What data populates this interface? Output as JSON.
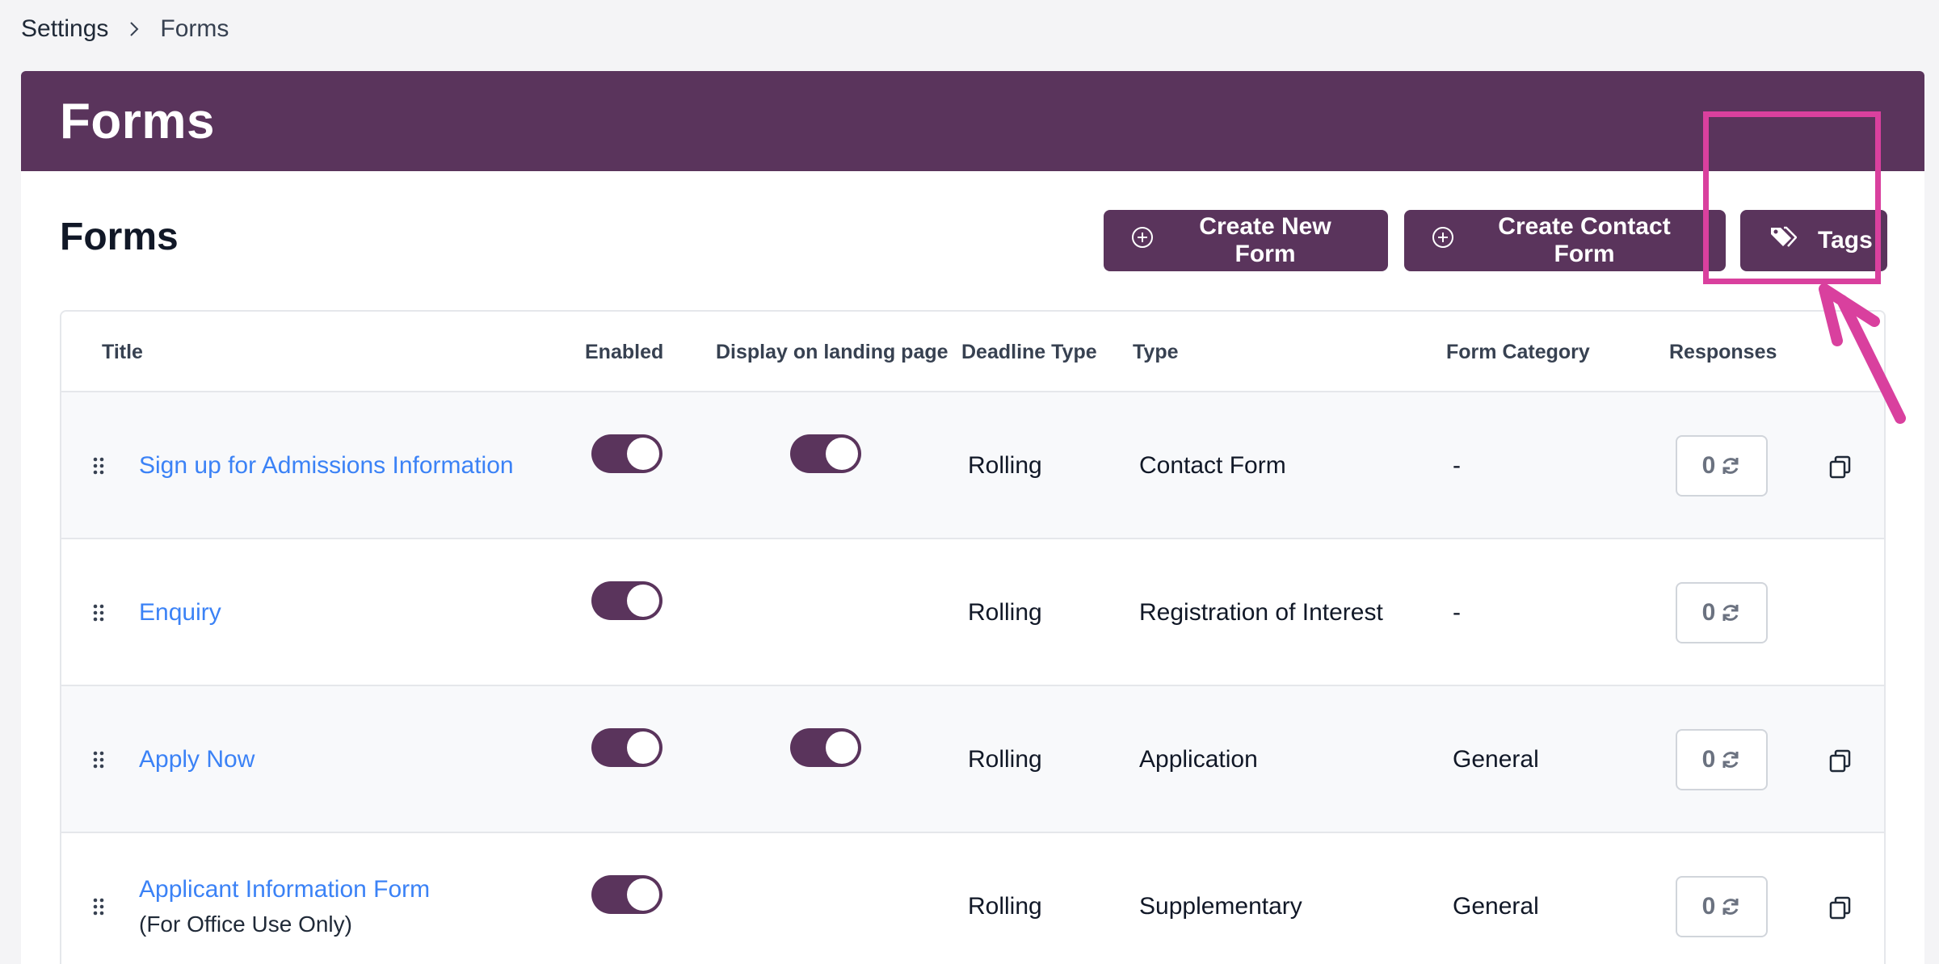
{
  "breadcrumb": {
    "parent": "Settings",
    "current": "Forms"
  },
  "header": {
    "title": "Forms"
  },
  "section": {
    "title": "Forms"
  },
  "toolbar": {
    "create_form": "Create New Form",
    "create_contact": "Create Contact Form",
    "tags": "Tags"
  },
  "table": {
    "columns": {
      "title": "Title",
      "enabled": "Enabled",
      "landing": "Display on landing page",
      "deadline": "Deadline Type",
      "type": "Type",
      "category": "Form Category",
      "responses": "Responses"
    },
    "rows": [
      {
        "title": "Sign up for Admissions Information",
        "subtitle": "",
        "enabled": true,
        "landing": true,
        "deadline": "Rolling",
        "type": "Contact Form",
        "category": "-",
        "responses": "0",
        "copy": true
      },
      {
        "title": "Enquiry",
        "subtitle": "",
        "enabled": true,
        "landing": false,
        "deadline": "Rolling",
        "type": "Registration of Interest",
        "category": "-",
        "responses": "0",
        "copy": false
      },
      {
        "title": "Apply Now",
        "subtitle": "",
        "enabled": true,
        "landing": true,
        "deadline": "Rolling",
        "type": "Application",
        "category": "General",
        "responses": "0",
        "copy": true
      },
      {
        "title": "Applicant Information Form",
        "subtitle": "(For Office Use Only)",
        "enabled": true,
        "landing": false,
        "deadline": "Rolling",
        "type": "Supplementary",
        "category": "General",
        "responses": "0",
        "copy": true
      }
    ]
  },
  "icons": {
    "breadcrumb_sep": "chevron-right-icon",
    "create": "plus-circle-icon",
    "tags": "tags-icon",
    "drag": "drag-handle-icon",
    "refresh": "refresh-icon",
    "copy": "copy-icon"
  },
  "colors": {
    "brand": "#5a345c",
    "link": "#3b82f6",
    "annotation": "#d9409e"
  }
}
